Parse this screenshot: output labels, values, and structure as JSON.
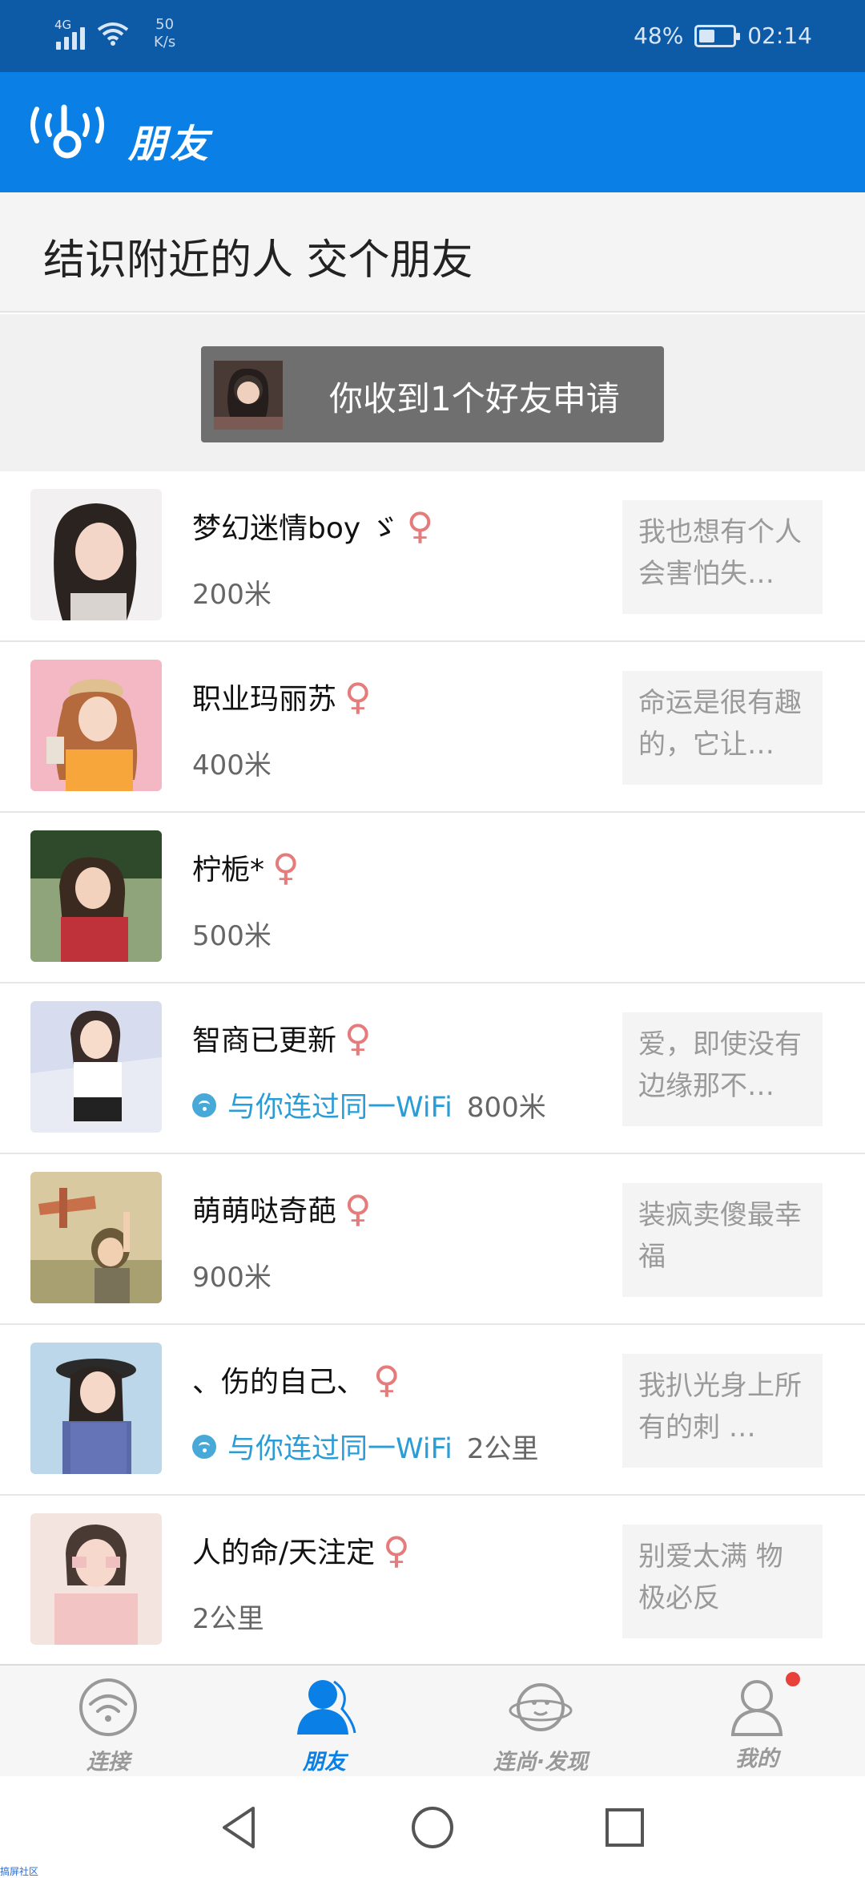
{
  "status_bar": {
    "network": "4G",
    "speed_value": "50",
    "speed_unit": "K/s",
    "battery_percent": "48%",
    "battery_level": 0.48,
    "time": "02:14"
  },
  "app_bar": {
    "title": "朋友",
    "logo_icon": "wifi-key-logo-icon"
  },
  "banner": {
    "text": "结识附近的人 交个朋友"
  },
  "friend_request": {
    "label": "你收到1个好友申请"
  },
  "people": [
    {
      "name": "梦幻迷情boy ゞ",
      "gender": "♀",
      "wifi_tag": "",
      "distance": "200米",
      "message": "我也想有个人会害怕失…"
    },
    {
      "name": "职业玛丽苏",
      "gender": "♀",
      "wifi_tag": "",
      "distance": "400米",
      "message": "命运是很有趣的，它让…"
    },
    {
      "name": "柠栀*",
      "gender": "♀",
      "wifi_tag": "",
      "distance": "500米",
      "message": ""
    },
    {
      "name": "智商已更新",
      "gender": "♀",
      "wifi_tag": "与你连过同一WiFi",
      "distance": "800米",
      "message": "爱，即使没有边缘那不…"
    },
    {
      "name": "萌萌哒奇葩",
      "gender": "♀",
      "wifi_tag": "",
      "distance": "900米",
      "message": "装疯卖傻最幸福"
    },
    {
      "name": "、伤的自己、",
      "gender": "♀",
      "wifi_tag": "与你连过同一WiFi",
      "distance": "2公里",
      "message": "我扒光身上所有的刺 …"
    },
    {
      "name": "人的命/天注定",
      "gender": "♀",
      "wifi_tag": "",
      "distance": "2公里",
      "message": "别爱太满 物极必反"
    }
  ],
  "bottom_nav": {
    "items": [
      {
        "label": "连接",
        "icon": "wifi-icon"
      },
      {
        "label": "朋友",
        "icon": "person-icon"
      },
      {
        "label": "连尚·发现",
        "icon": "planet-face-icon"
      },
      {
        "label": "我的",
        "icon": "user-outline-icon"
      }
    ],
    "active_index": 1
  },
  "colors": {
    "status_bar": "#0d5aa7",
    "primary": "#0a80e6",
    "female": "#e57b7b",
    "wifi_tag": "#2a9dd6",
    "badge": "#e8403a"
  },
  "watermark": "搞屏社区"
}
